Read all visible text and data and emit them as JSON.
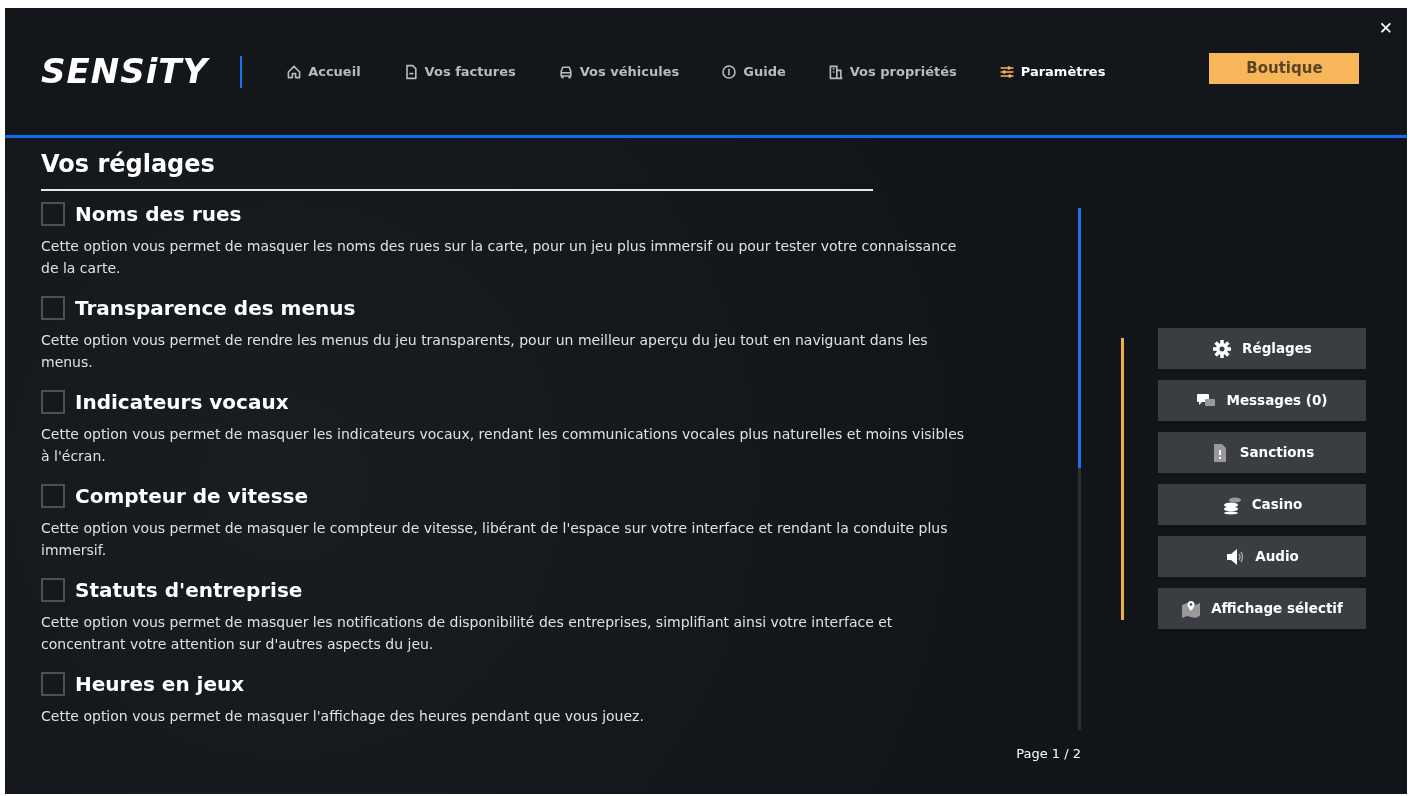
{
  "header": {
    "logo": "SENSiTY",
    "nav": [
      {
        "label": "Accueil",
        "kind": "home",
        "selected": false
      },
      {
        "label": "Vos factures",
        "kind": "file",
        "selected": false
      },
      {
        "label": "Vos véhicules",
        "kind": "car",
        "selected": false
      },
      {
        "label": "Guide",
        "kind": "info",
        "selected": false
      },
      {
        "label": "Vos propriétés",
        "kind": "building",
        "selected": false
      },
      {
        "label": "Paramètres",
        "kind": "sliders",
        "selected": true
      }
    ],
    "shop_button": "Boutique",
    "close": "✕"
  },
  "title": "Vos réglages",
  "options": [
    {
      "label": "Noms des rues",
      "checked": false,
      "description": "Cette option vous permet de masquer les noms des rues sur la carte, pour un jeu plus immersif ou pour tester votre connaissance de la carte."
    },
    {
      "label": "Transparence des menus",
      "checked": false,
      "description": "Cette option vous permet de rendre les menus du jeu transparents, pour un meilleur aperçu du jeu tout en naviguant dans les menus."
    },
    {
      "label": "Indicateurs vocaux",
      "checked": false,
      "description": "Cette option vous permet de masquer les indicateurs vocaux, rendant les communications vocales plus naturelles et moins visibles à l'écran."
    },
    {
      "label": "Compteur de vitesse",
      "checked": false,
      "description": "Cette option vous permet de masquer le compteur de vitesse, libérant de l'espace sur votre interface et rendant la conduite plus immersif."
    },
    {
      "label": "Statuts d'entreprise",
      "checked": false,
      "description": "Cette option vous permet de masquer les notifications de disponibilité des entreprises, simplifiant ainsi votre interface et concentrant votre attention sur d'autres aspects du jeu."
    },
    {
      "label": "Heures en jeux",
      "checked": false,
      "description": "Cette option vous permet de masquer l'affichage des heures pendant que vous jouez."
    }
  ],
  "pager": "Page 1 / 2",
  "side_menu": [
    {
      "label": "Réglages",
      "kind": "gear"
    },
    {
      "label": "Messages (0)",
      "kind": "chat"
    },
    {
      "label": "Sanctions",
      "kind": "doc"
    },
    {
      "label": "Casino",
      "kind": "coins"
    },
    {
      "label": "Audio",
      "kind": "speaker"
    },
    {
      "label": "Affichage sélectif",
      "kind": "map"
    }
  ]
}
